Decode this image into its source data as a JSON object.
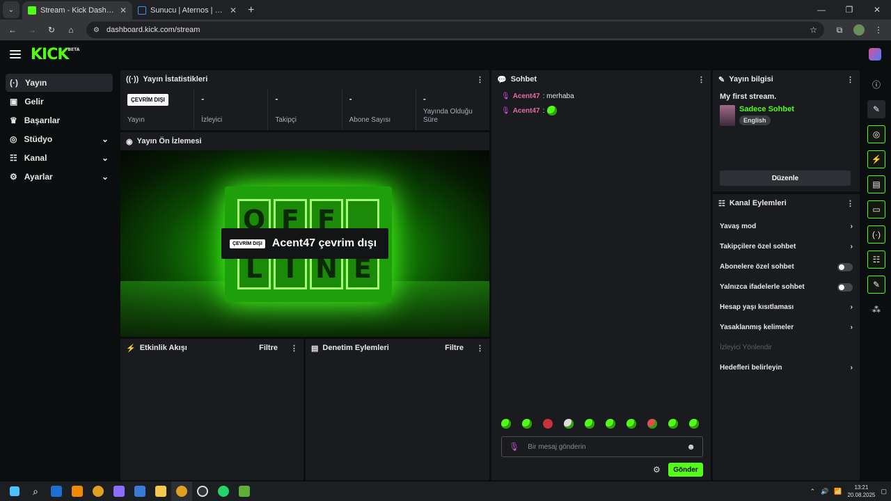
{
  "browser": {
    "tabs": [
      {
        "title": "Stream - Kick Dashboard",
        "active": true
      },
      {
        "title": "Sunucu | Aternos | Ücretsiz Min",
        "active": false
      }
    ],
    "url": "dashboard.kick.com/stream"
  },
  "header": {
    "logo": "KICK",
    "logo_badge": "BETA"
  },
  "sidebar": {
    "items": [
      {
        "label": "Yayın",
        "icon": "broadcast-icon",
        "active": true
      },
      {
        "label": "Gelir",
        "icon": "revenue-icon"
      },
      {
        "label": "Başarılar",
        "icon": "trophy-icon"
      },
      {
        "label": "Stüdyo",
        "icon": "studio-icon",
        "expandable": true
      },
      {
        "label": "Kanal",
        "icon": "channel-icon",
        "expandable": true
      },
      {
        "label": "Ayarlar",
        "icon": "gear-icon",
        "expandable": true
      }
    ]
  },
  "stats": {
    "title": "Yayın İstatistikleri",
    "offline_badge": "ÇEVRİM DIŞI",
    "items": [
      {
        "value": "",
        "label": "Yayın"
      },
      {
        "value": "-",
        "label": "İzleyici"
      },
      {
        "value": "-",
        "label": "Takipçi"
      },
      {
        "value": "-",
        "label": "Abone Sayısı"
      },
      {
        "value": "-",
        "label": "Yayında Olduğu Süre"
      }
    ]
  },
  "preview": {
    "title": "Yayın Ön İzlemesi",
    "badge": "ÇEVRİM DIŞI",
    "message": "Acent47 çevrim dışı",
    "sign_row1": [
      "O",
      "F",
      "F",
      ""
    ],
    "sign_row2": [
      "L",
      "I",
      "N",
      "E"
    ]
  },
  "activity": {
    "title": "Etkinlik Akışı",
    "filter": "Filtre"
  },
  "moderation": {
    "title": "Denetim Eylemleri",
    "filter": "Filtre"
  },
  "chat": {
    "title": "Sohbet",
    "messages": [
      {
        "user": "Acent47",
        "text": ": merhaba"
      },
      {
        "user": "Acent47",
        "text": ":"
      }
    ],
    "placeholder": "Bir mesaj gönderin",
    "send": "Gönder"
  },
  "stream_info": {
    "title": "Yayın bilgisi",
    "stream_title": "My first stream.",
    "category": "Sadece Sohbet",
    "language": "English",
    "edit": "Düzenle"
  },
  "channel_actions": {
    "title": "Kanal Eylemleri",
    "items": [
      {
        "label": "Yavaş mod",
        "type": "chevron"
      },
      {
        "label": "Takipçilere özel sohbet",
        "type": "chevron"
      },
      {
        "label": "Abonelere özel sohbet",
        "type": "toggle"
      },
      {
        "label": "Yalnızca ifadelerle sohbet",
        "type": "toggle"
      },
      {
        "label": "Hesap yaşı kısıtlaması",
        "type": "chevron"
      },
      {
        "label": "Yasaklanmış kelimeler",
        "type": "chevron"
      },
      {
        "label": "İzleyici Yönlendir",
        "type": "disabled"
      },
      {
        "label": "Hedefleri belirleyin",
        "type": "chevron"
      }
    ]
  },
  "taskbar": {
    "time": "13:21",
    "date": "20.08.2025"
  },
  "colors": {
    "accent": "#53fc18",
    "panel": "#191b1f",
    "background": "#0b0e0f"
  }
}
